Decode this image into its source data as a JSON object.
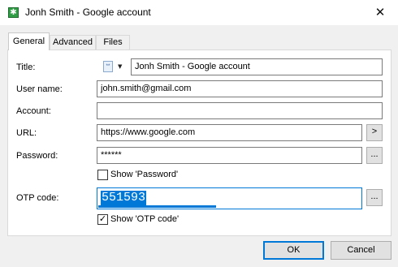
{
  "window": {
    "title": "Jonh Smith - Google account",
    "app_icon": "✱",
    "close_icon": "✕"
  },
  "tabs": [
    {
      "label": "General",
      "active": true
    },
    {
      "label": "Advanced",
      "active": false
    },
    {
      "label": "Files",
      "active": false
    }
  ],
  "form": {
    "title_label": "Title:",
    "title_value": "Jonh Smith - Google account",
    "title_icon": "**",
    "title_icon_dropdown": "▼",
    "username_label": "User name:",
    "username_value": "john.smith@gmail.com",
    "account_label": "Account:",
    "account_value": "",
    "url_label": "URL:",
    "url_value": "https://www.google.com",
    "url_open_label": ">",
    "password_label": "Password:",
    "password_value": "******",
    "password_more_label": "...",
    "show_password_label": "Show 'Password'",
    "show_password_checked": false,
    "otp_label": "OTP code:",
    "otp_value": "551593",
    "otp_more_label": "...",
    "otp_progress": 0.45,
    "show_otp_label": "Show 'OTP code'",
    "show_otp_checked": true,
    "check_mark": "✓"
  },
  "footer": {
    "ok_label": "OK",
    "cancel_label": "Cancel"
  },
  "colors": {
    "accent": "#0078d7",
    "app_icon": "#2f9e44"
  }
}
